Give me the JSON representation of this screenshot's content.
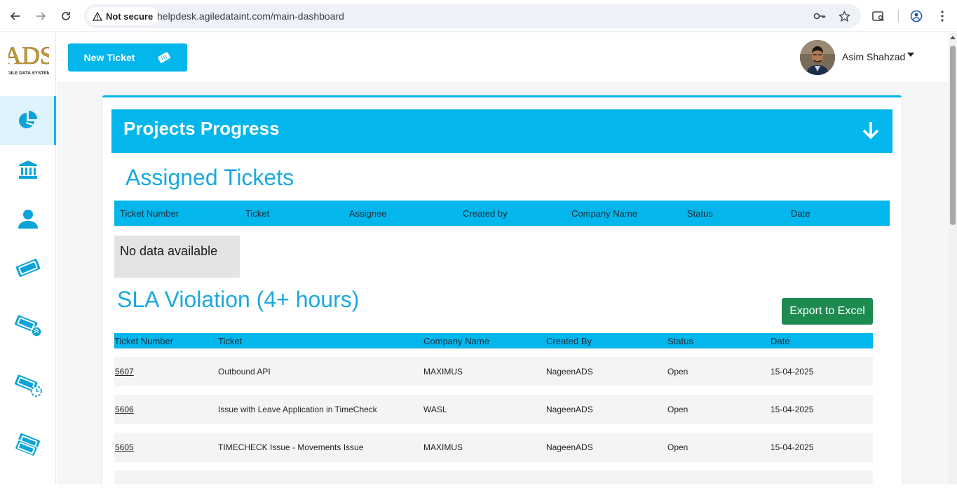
{
  "browser": {
    "security_label": "Not secure",
    "url": "helpdesk.agiledataint.com/main-dashboard"
  },
  "sidebar": {
    "logo_text": "ADS",
    "logo_subtitle": "AGILE DATA SYSTEMS",
    "items": [
      {
        "icon": "dashboard-pie-icon",
        "active": true
      },
      {
        "icon": "bank-building-icon",
        "active": false
      },
      {
        "icon": "user-icon",
        "active": false
      },
      {
        "icon": "ticket-icon",
        "active": false
      },
      {
        "icon": "ticket-upload-icon",
        "active": false
      },
      {
        "icon": "ticket-clock-icon",
        "active": false
      },
      {
        "icon": "tickets-multiple-icon",
        "active": false
      }
    ]
  },
  "header": {
    "new_ticket_label": "New Ticket",
    "user_name": "Asim Shahzad"
  },
  "projects_progress": {
    "title": "Projects Progress"
  },
  "assigned_tickets": {
    "title": "Assigned Tickets",
    "columns": [
      "Ticket Number",
      "Ticket",
      "Assignee",
      "Created by",
      "Company Name",
      "Status",
      "Date"
    ],
    "empty_message": "No data available"
  },
  "sla_violation": {
    "title": "SLA Violation (4+ hours)",
    "export_label": "Export to Excel",
    "columns": [
      "Ticket Number",
      "Ticket",
      "Company Name",
      "Created By",
      "Status",
      "Date"
    ],
    "rows": [
      {
        "number": "5607",
        "ticket": "Outbound API",
        "company": "MAXIMUS",
        "created_by": "NageenADS",
        "status": "Open",
        "date": "15-04-2025"
      },
      {
        "number": "5606",
        "ticket": "Issue with Leave Application in TimeCheck",
        "company": "WASL",
        "created_by": "NageenADS",
        "status": "Open",
        "date": "15-04-2025"
      },
      {
        "number": "5605",
        "ticket": "TIMECHECK Issue - Movements Issue",
        "company": "MAXIMUS",
        "created_by": "NageenADS",
        "status": "Open",
        "date": "15-04-2025"
      }
    ]
  },
  "colors": {
    "accent": "#03b6ec",
    "export_green": "#1d8a50",
    "title_blue": "#1aa9e0"
  }
}
